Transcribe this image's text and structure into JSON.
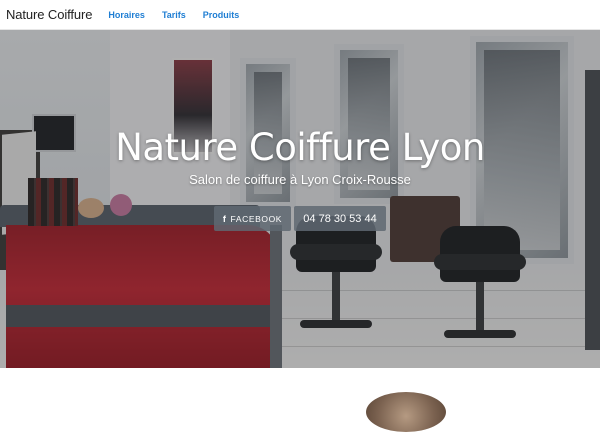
{
  "navbar": {
    "brand": "Nature Coiffure",
    "links": [
      {
        "label": "Horaires"
      },
      {
        "label": "Tarifs"
      },
      {
        "label": "Produits"
      }
    ],
    "link_color": "#1f7ed3"
  },
  "hero": {
    "title": "Nature Coiffure Lyon",
    "subtitle": "Salon de coiffure à Lyon Croix-Rousse",
    "facebook_button": {
      "icon": "facebook-icon",
      "label": "FACEBOOK"
    },
    "phone_button": {
      "label": "04 78 30 53 44"
    },
    "accent_colors": {
      "counter_red": "#c52836",
      "button_bg": "#5f6872"
    }
  }
}
